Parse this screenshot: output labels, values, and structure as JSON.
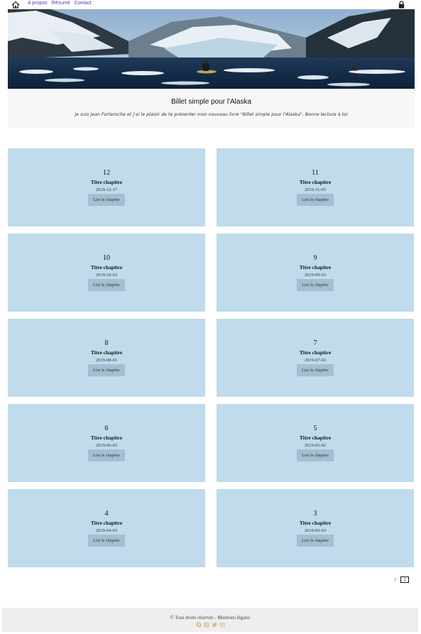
{
  "nav": {
    "home_icon": "home-icon",
    "links": [
      {
        "label": "A propos"
      },
      {
        "label": "Résumé"
      },
      {
        "label": "Contact"
      }
    ],
    "lock_icon": "lock-icon"
  },
  "intro": {
    "title": "Billet simple pour l'Alaska",
    "text": "Je suis Jean Forteroche et j'ai le plaisir de te présenter mon nouveau livre \"Billet simple pour l'Alaska\". Bonne lecture à toi"
  },
  "chapters": [
    {
      "number": "12",
      "title": "Titre chapitre",
      "date": "2019-12-17",
      "button": "Lire le chapitre"
    },
    {
      "number": "11",
      "title": "Titre chapitre",
      "date": "2019-11-05",
      "button": "Lire le chapitre"
    },
    {
      "number": "10",
      "title": "Titre chapitre",
      "date": "2019-10-03",
      "button": "Lire le chapitre"
    },
    {
      "number": "9",
      "title": "Titre chapitre",
      "date": "2019-09-03",
      "button": "Lire le chapitre"
    },
    {
      "number": "8",
      "title": "Titre chapitre",
      "date": "2019-08-01",
      "button": "Lire le chapitre"
    },
    {
      "number": "7",
      "title": "Titre chapitre",
      "date": "2019-07-03",
      "button": "Lire le chapitre"
    },
    {
      "number": "6",
      "title": "Titre chapitre",
      "date": "2019-06-03",
      "button": "Lire le chapitre"
    },
    {
      "number": "5",
      "title": "Titre chapitre",
      "date": "2019-05-02",
      "button": "Lire le chapitre"
    },
    {
      "number": "4",
      "title": "Titre chapitre",
      "date": "2019-04-03",
      "button": "Lire le chapitre"
    },
    {
      "number": "3",
      "title": "Titre chapitre",
      "date": "2019-03-03",
      "button": "Lire le chapitre"
    }
  ],
  "pagination": {
    "pages": [
      "1",
      "2"
    ],
    "current": "2"
  },
  "footer": {
    "copyright": "© Tous droits réservés",
    "separator": " - ",
    "legal": "Mentions légales",
    "socials": [
      "facebook-icon",
      "instagram-icon",
      "twitter-icon",
      "mail-icon"
    ]
  },
  "colors": {
    "nav_link": "#4a3bb8",
    "card_bg": "#bfdbec",
    "button_bg": "#a3bfd1",
    "social_icon": "#d4b98a",
    "intro_bg": "#f7f7f7",
    "footer_bg": "#eeeeee"
  }
}
